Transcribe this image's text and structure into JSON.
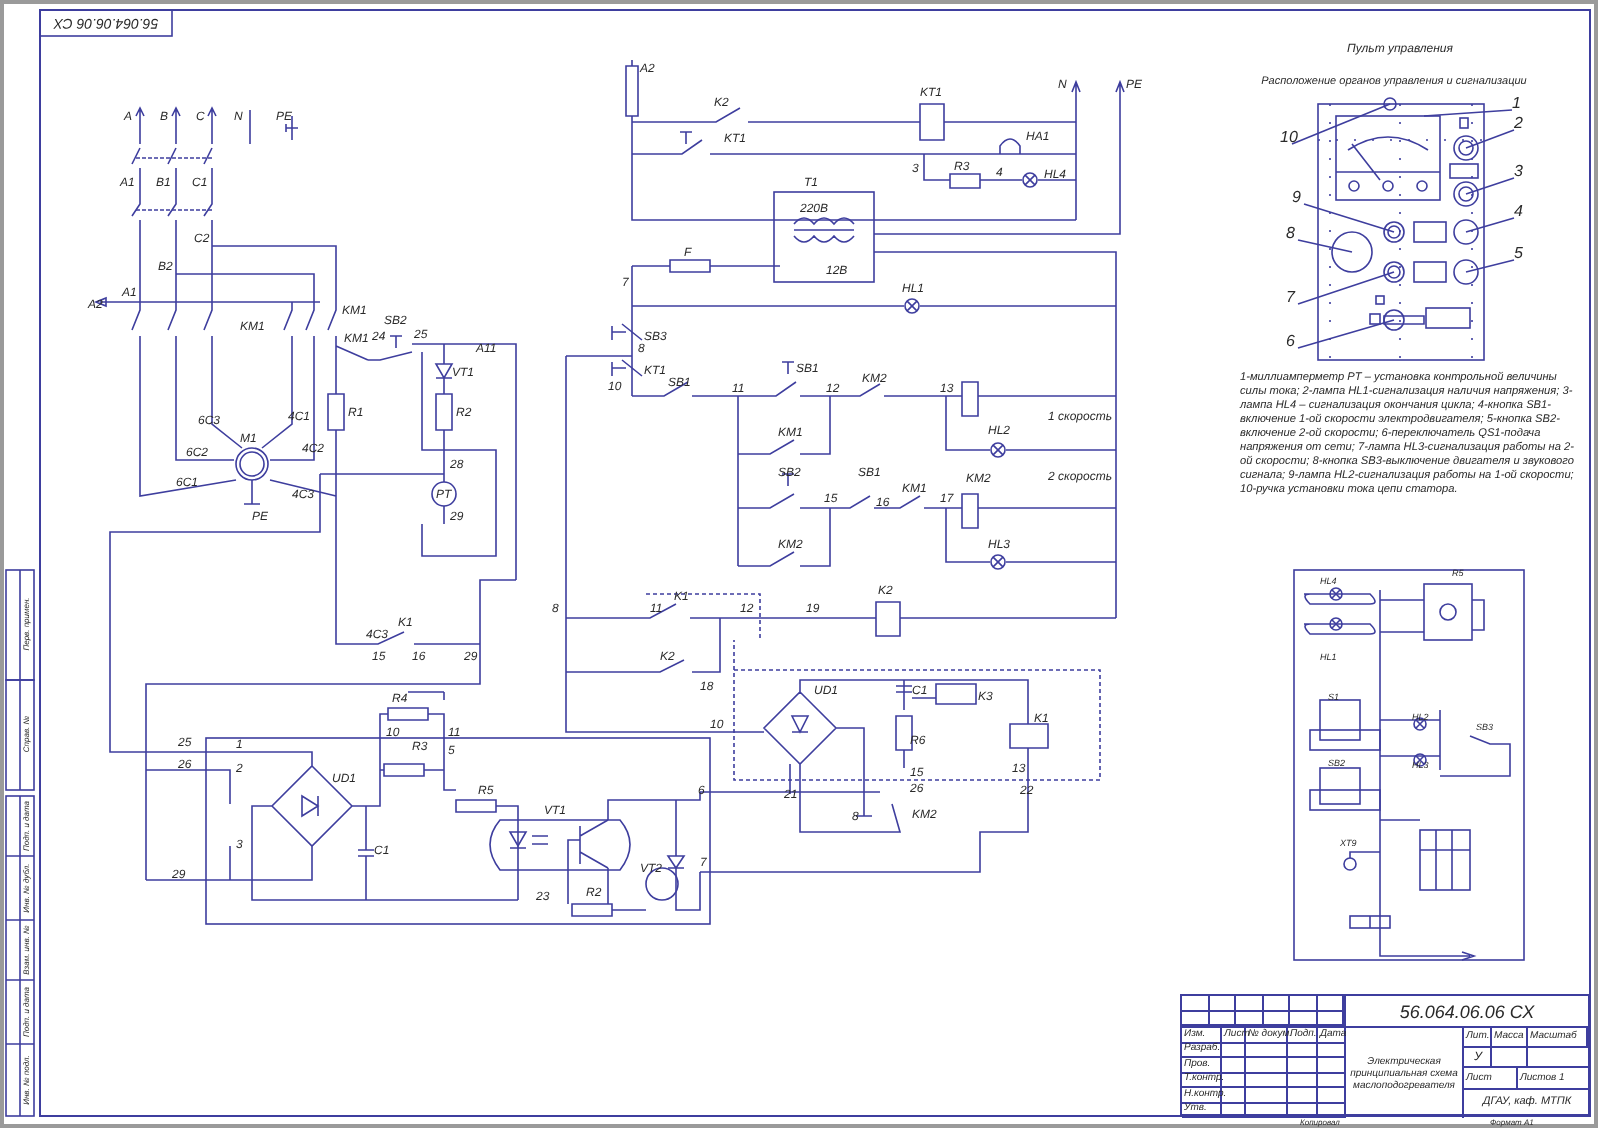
{
  "stamp": "56.064.06.06 СХ",
  "power_circuit": {
    "labels": [
      "A",
      "B",
      "C",
      "N",
      "PE",
      "A1",
      "B1",
      "C1",
      "C2",
      "B2",
      "A2",
      "A1",
      "KM1",
      "KM1",
      "KM1",
      "24",
      "SB2",
      "25",
      "A11",
      "VT1",
      "R1",
      "R2",
      "28",
      "PT",
      "29",
      "6C3",
      "4C1",
      "M1",
      "6C2",
      "4C2",
      "6C1",
      "4C3",
      "PE",
      "4C3",
      "K1",
      "15",
      "16",
      "29"
    ]
  },
  "control_circuit": {
    "labels": [
      "N",
      "PE",
      "A2",
      "K2",
      "KT1",
      "KT1",
      "HA1",
      "3",
      "R3",
      "4",
      "HL4",
      "T1",
      "220В",
      "12В",
      "F",
      "7",
      "HL1",
      "SB3",
      "8",
      "KT1",
      "10",
      "SB1",
      "11",
      "SB1",
      "12",
      "KM2",
      "13",
      "HL2",
      "1 скорость",
      "KM1",
      "SB2",
      "2 скорость",
      "15",
      "SB1",
      "16",
      "KM1",
      "17",
      "KM2",
      "HL3",
      "KM2"
    ]
  },
  "relay_block": {
    "labels": [
      "8",
      "11",
      "K1",
      "12",
      "19",
      "K2",
      "K2",
      "18",
      "UD1",
      "10",
      "C1",
      "K3",
      "R6",
      "15",
      "26",
      "K1",
      "13",
      "22",
      "21",
      "8",
      "KM2",
      "25",
      "26",
      "1",
      "2",
      "3",
      "29",
      "UD1",
      "C1",
      "R4",
      "10",
      "R3",
      "11",
      "5",
      "R5",
      "VT1",
      "23",
      "R2",
      "VT2",
      "6",
      "7"
    ]
  },
  "control_panel": {
    "title": "Пульт управления",
    "subtitle": "Расположение органов управления и сигнализации",
    "callouts": [
      "1",
      "2",
      "10",
      "3",
      "9",
      "4",
      "8",
      "5",
      "7",
      "6"
    ],
    "legend": "1-миллиамперметр PT – установка контрольной величины силы тока; 2-лампа HL1-сигнализация наличия напряжения; 3-лампа HL4 – сигнализация окончания цикла; 4-кнопка SB1-включение 1-ой скорости электродвигателя; 5-кнопка SB2-включение 2-ой скорости; 6-переключатель QS1-подача напряжения от сети; 7-лампа HL3-сигнализация работы на 2-ой скорости; 8-кнопка SB3-выключение двигателя и звукового сигнала; 9-лампа HL2-сигнализация работы на 1-ой скорости; 10-ручка установки тока цепи статора."
  },
  "wiring_diagram": {
    "labels": [
      "HL4",
      "R5",
      "HL1",
      "S1",
      "HL2",
      "SB3",
      "SB2",
      "HL3",
      "XT9"
    ]
  },
  "margin_strip": [
    "Перв. примен.",
    "Справ. №",
    "Подп. и дата",
    "Инв. № дубл.",
    "Взам. инв. №",
    "Подп. и дата",
    "Инв. № подл."
  ],
  "title_block": {
    "designation": "56.064.06.06 СХ",
    "columns": [
      "Изм.",
      "Лист",
      "№ докум.",
      "Подп.",
      "Дата"
    ],
    "roles": [
      "Разраб.",
      "Пров.",
      "Т.контр.",
      "Н.контр.",
      "Утв."
    ],
    "name": "Электрическая принципиальная схема маслоподогревателя",
    "stage_headers": [
      "Лит.",
      "Масса",
      "Масштаб"
    ],
    "stage": "У",
    "sheet": "Лист",
    "sheets": "Листов 1",
    "organization": "ДГАУ, каф. МТПК"
  },
  "footer": [
    "Копировал",
    "Формат А1"
  ]
}
